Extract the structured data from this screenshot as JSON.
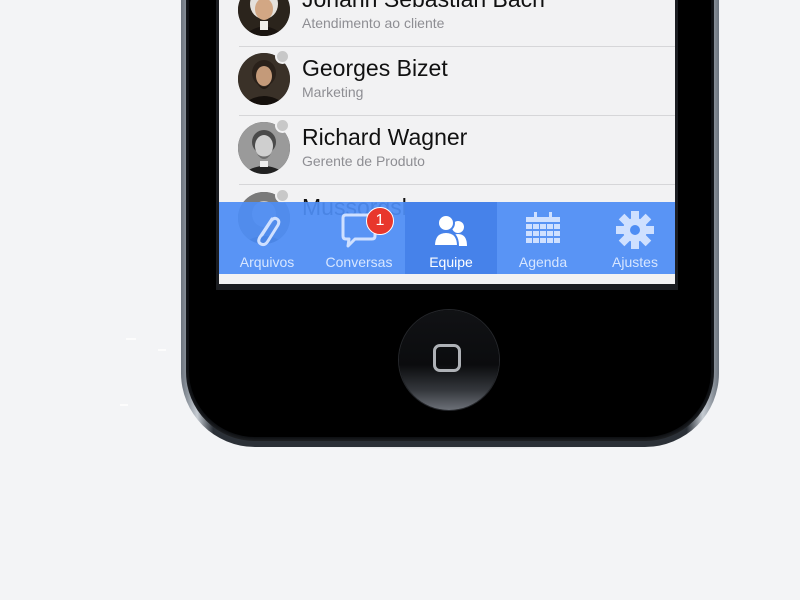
{
  "contacts": [
    {
      "name": "Johann Sebastian Bach",
      "role": "Atendimento ao cliente",
      "status": "offline"
    },
    {
      "name": "Georges Bizet",
      "role": "Marketing",
      "status": "offline"
    },
    {
      "name": "Richard Wagner",
      "role": "Gerente de Produto",
      "status": "offline"
    },
    {
      "name": "Mussorgsky",
      "role": "",
      "status": "offline"
    }
  ],
  "tabbar": {
    "tabs": [
      {
        "label": "Arquivos",
        "icon": "paperclip-icon"
      },
      {
        "label": "Conversas",
        "icon": "chat-bubble-icon",
        "badge": "1"
      },
      {
        "label": "Equipe",
        "icon": "team-icon",
        "active": true
      },
      {
        "label": "Agenda",
        "icon": "calendar-icon"
      },
      {
        "label": "Ajustes",
        "icon": "gear-icon"
      }
    ]
  },
  "colors": {
    "tabbar_background": "#4e8df4",
    "tab_active_background": "#4682ea",
    "badge": "#e8372c",
    "presence_offline": "#c8c8c8"
  }
}
